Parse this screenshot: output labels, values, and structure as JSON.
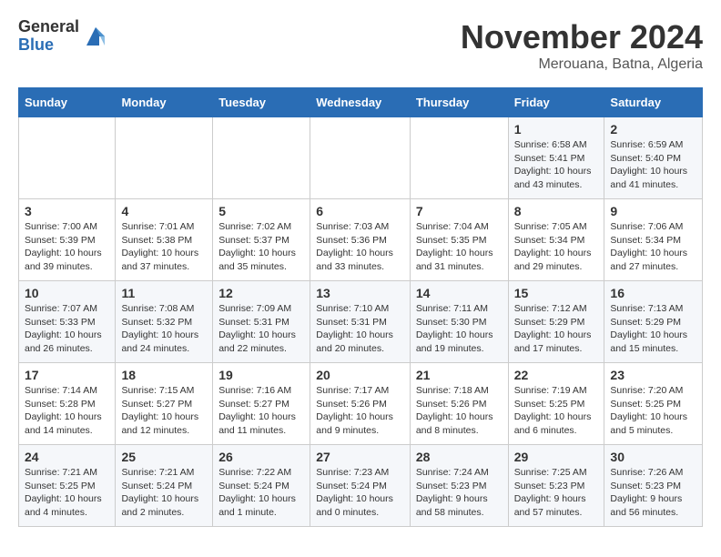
{
  "logo": {
    "general": "General",
    "blue": "Blue"
  },
  "header": {
    "month": "November 2024",
    "location": "Merouana, Batna, Algeria"
  },
  "weekdays": [
    "Sunday",
    "Monday",
    "Tuesday",
    "Wednesday",
    "Thursday",
    "Friday",
    "Saturday"
  ],
  "weeks": [
    [
      {
        "day": "",
        "info": ""
      },
      {
        "day": "",
        "info": ""
      },
      {
        "day": "",
        "info": ""
      },
      {
        "day": "",
        "info": ""
      },
      {
        "day": "",
        "info": ""
      },
      {
        "day": "1",
        "info": "Sunrise: 6:58 AM\nSunset: 5:41 PM\nDaylight: 10 hours\nand 43 minutes."
      },
      {
        "day": "2",
        "info": "Sunrise: 6:59 AM\nSunset: 5:40 PM\nDaylight: 10 hours\nand 41 minutes."
      }
    ],
    [
      {
        "day": "3",
        "info": "Sunrise: 7:00 AM\nSunset: 5:39 PM\nDaylight: 10 hours\nand 39 minutes."
      },
      {
        "day": "4",
        "info": "Sunrise: 7:01 AM\nSunset: 5:38 PM\nDaylight: 10 hours\nand 37 minutes."
      },
      {
        "day": "5",
        "info": "Sunrise: 7:02 AM\nSunset: 5:37 PM\nDaylight: 10 hours\nand 35 minutes."
      },
      {
        "day": "6",
        "info": "Sunrise: 7:03 AM\nSunset: 5:36 PM\nDaylight: 10 hours\nand 33 minutes."
      },
      {
        "day": "7",
        "info": "Sunrise: 7:04 AM\nSunset: 5:35 PM\nDaylight: 10 hours\nand 31 minutes."
      },
      {
        "day": "8",
        "info": "Sunrise: 7:05 AM\nSunset: 5:34 PM\nDaylight: 10 hours\nand 29 minutes."
      },
      {
        "day": "9",
        "info": "Sunrise: 7:06 AM\nSunset: 5:34 PM\nDaylight: 10 hours\nand 27 minutes."
      }
    ],
    [
      {
        "day": "10",
        "info": "Sunrise: 7:07 AM\nSunset: 5:33 PM\nDaylight: 10 hours\nand 26 minutes."
      },
      {
        "day": "11",
        "info": "Sunrise: 7:08 AM\nSunset: 5:32 PM\nDaylight: 10 hours\nand 24 minutes."
      },
      {
        "day": "12",
        "info": "Sunrise: 7:09 AM\nSunset: 5:31 PM\nDaylight: 10 hours\nand 22 minutes."
      },
      {
        "day": "13",
        "info": "Sunrise: 7:10 AM\nSunset: 5:31 PM\nDaylight: 10 hours\nand 20 minutes."
      },
      {
        "day": "14",
        "info": "Sunrise: 7:11 AM\nSunset: 5:30 PM\nDaylight: 10 hours\nand 19 minutes."
      },
      {
        "day": "15",
        "info": "Sunrise: 7:12 AM\nSunset: 5:29 PM\nDaylight: 10 hours\nand 17 minutes."
      },
      {
        "day": "16",
        "info": "Sunrise: 7:13 AM\nSunset: 5:29 PM\nDaylight: 10 hours\nand 15 minutes."
      }
    ],
    [
      {
        "day": "17",
        "info": "Sunrise: 7:14 AM\nSunset: 5:28 PM\nDaylight: 10 hours\nand 14 minutes."
      },
      {
        "day": "18",
        "info": "Sunrise: 7:15 AM\nSunset: 5:27 PM\nDaylight: 10 hours\nand 12 minutes."
      },
      {
        "day": "19",
        "info": "Sunrise: 7:16 AM\nSunset: 5:27 PM\nDaylight: 10 hours\nand 11 minutes."
      },
      {
        "day": "20",
        "info": "Sunrise: 7:17 AM\nSunset: 5:26 PM\nDaylight: 10 hours\nand 9 minutes."
      },
      {
        "day": "21",
        "info": "Sunrise: 7:18 AM\nSunset: 5:26 PM\nDaylight: 10 hours\nand 8 minutes."
      },
      {
        "day": "22",
        "info": "Sunrise: 7:19 AM\nSunset: 5:25 PM\nDaylight: 10 hours\nand 6 minutes."
      },
      {
        "day": "23",
        "info": "Sunrise: 7:20 AM\nSunset: 5:25 PM\nDaylight: 10 hours\nand 5 minutes."
      }
    ],
    [
      {
        "day": "24",
        "info": "Sunrise: 7:21 AM\nSunset: 5:25 PM\nDaylight: 10 hours\nand 4 minutes."
      },
      {
        "day": "25",
        "info": "Sunrise: 7:21 AM\nSunset: 5:24 PM\nDaylight: 10 hours\nand 2 minutes."
      },
      {
        "day": "26",
        "info": "Sunrise: 7:22 AM\nSunset: 5:24 PM\nDaylight: 10 hours\nand 1 minute."
      },
      {
        "day": "27",
        "info": "Sunrise: 7:23 AM\nSunset: 5:24 PM\nDaylight: 10 hours\nand 0 minutes."
      },
      {
        "day": "28",
        "info": "Sunrise: 7:24 AM\nSunset: 5:23 PM\nDaylight: 9 hours\nand 58 minutes."
      },
      {
        "day": "29",
        "info": "Sunrise: 7:25 AM\nSunset: 5:23 PM\nDaylight: 9 hours\nand 57 minutes."
      },
      {
        "day": "30",
        "info": "Sunrise: 7:26 AM\nSunset: 5:23 PM\nDaylight: 9 hours\nand 56 minutes."
      }
    ]
  ]
}
